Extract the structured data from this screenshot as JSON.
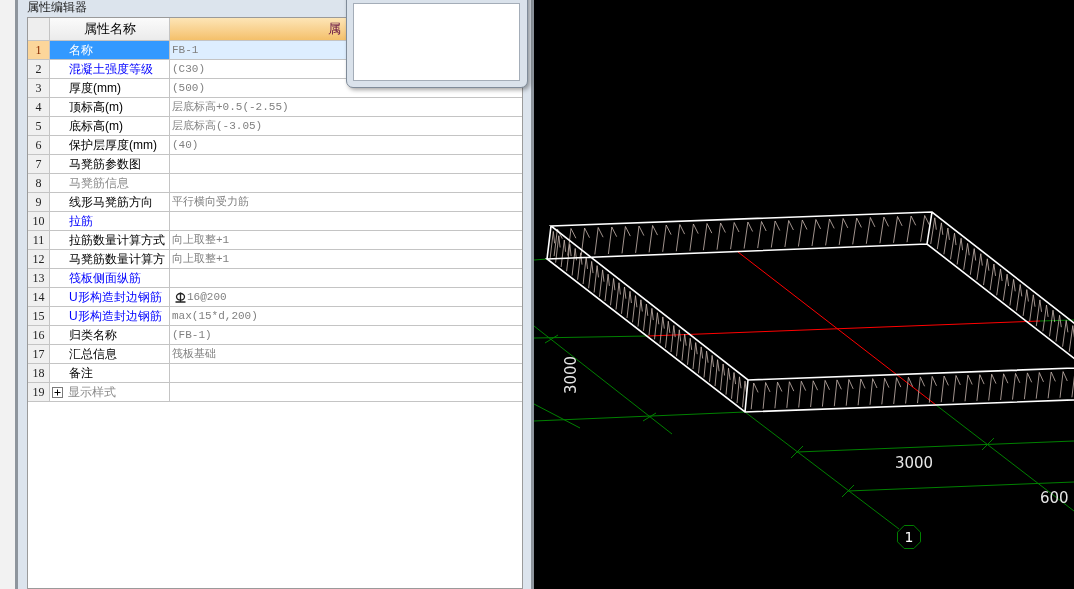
{
  "panel": {
    "title": "属性编辑器",
    "columns": [
      {
        "label": "属性名称"
      },
      {
        "label": "属"
      }
    ],
    "rows": [
      {
        "index": "1",
        "name": "名称",
        "value": "FB-1",
        "kind": "text",
        "selected": true,
        "public": false,
        "disabled": false
      },
      {
        "index": "2",
        "name": "混凝土强度等级",
        "value": "(C30)",
        "kind": "text",
        "selected": false,
        "public": true,
        "disabled": false
      },
      {
        "index": "3",
        "name": "厚度(mm)",
        "value": "(500)",
        "kind": "text",
        "selected": false,
        "public": false,
        "disabled": false
      },
      {
        "index": "4",
        "name": "顶标高(m)",
        "value": "层底标高+0.5(-2.55)",
        "kind": "text",
        "selected": false,
        "public": false,
        "disabled": false
      },
      {
        "index": "5",
        "name": "底标高(m)",
        "value": "层底标高(-3.05)",
        "kind": "text",
        "selected": false,
        "public": false,
        "disabled": false
      },
      {
        "index": "6",
        "name": "保护层厚度(mm)",
        "value": "(40)",
        "kind": "text",
        "selected": false,
        "public": false,
        "disabled": false
      },
      {
        "index": "7",
        "name": "马凳筋参数图",
        "kind": "text",
        "selected": false,
        "public": false,
        "disabled": false
      },
      {
        "index": "8",
        "name": "马凳筋信息",
        "kind": "text",
        "selected": false,
        "public": false,
        "disabled": true
      },
      {
        "index": "9",
        "name": "线形马凳筋方向",
        "value": "平行横向受力筋",
        "kind": "text",
        "selected": false,
        "public": false,
        "disabled": false
      },
      {
        "index": "10",
        "name": "拉筋",
        "kind": "text",
        "selected": false,
        "public": true,
        "disabled": false
      },
      {
        "index": "11",
        "name": "拉筋数量计算方式",
        "value": "向上取整+1",
        "kind": "text",
        "selected": false,
        "public": false,
        "disabled": false
      },
      {
        "index": "12",
        "name": "马凳筋数量计算方",
        "value": "向上取整+1",
        "kind": "text",
        "selected": false,
        "public": false,
        "disabled": false
      },
      {
        "index": "13",
        "name": "筏板侧面纵筋",
        "kind": "text",
        "selected": false,
        "public": true,
        "disabled": false
      },
      {
        "index": "14",
        "name": "U形构造封边钢筋",
        "value": "16@200",
        "kind": "rebar",
        "selected": false,
        "public": true,
        "disabled": false
      },
      {
        "index": "15",
        "name": "U形构造封边钢筋",
        "value": "max(15*d,200)",
        "kind": "text",
        "selected": false,
        "public": true,
        "disabled": false
      },
      {
        "index": "16",
        "name": "归类名称",
        "value": "(FB-1)",
        "kind": "text",
        "selected": false,
        "public": false,
        "disabled": false
      },
      {
        "index": "17",
        "name": "汇总信息",
        "value": "筏板基础",
        "kind": "text",
        "selected": false,
        "public": false,
        "disabled": false
      },
      {
        "index": "18",
        "name": "备注",
        "kind": "text",
        "selected": false,
        "public": false,
        "disabled": false
      },
      {
        "index": "19",
        "name": "显示样式",
        "kind": "group",
        "expanded": false,
        "selected": false,
        "public": false,
        "disabled": true
      }
    ]
  },
  "view_3d": {
    "dimension_labels": [
      {
        "text": "3000"
      },
      {
        "text": "3000"
      },
      {
        "text": "600"
      }
    ],
    "axis_bubble": "1"
  }
}
